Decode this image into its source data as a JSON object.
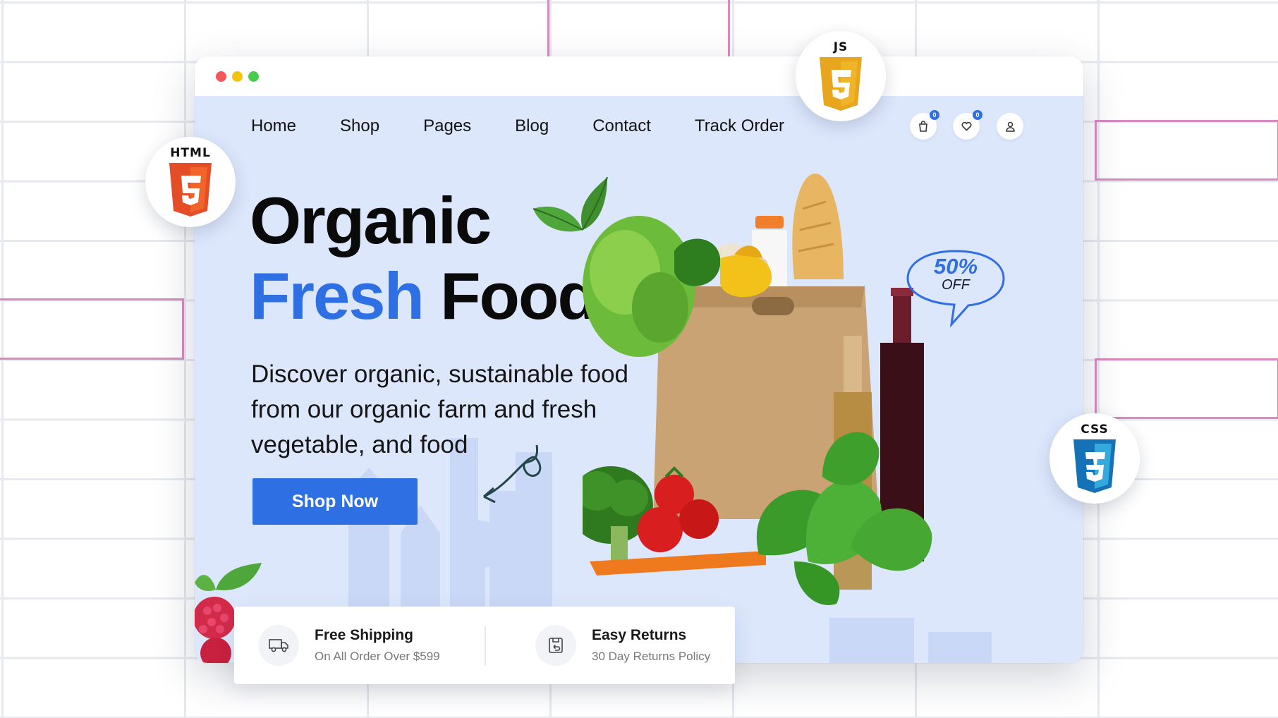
{
  "nav": {
    "items": [
      {
        "label": "Home"
      },
      {
        "label": "Shop"
      },
      {
        "label": "Pages"
      },
      {
        "label": "Blog"
      },
      {
        "label": "Contact"
      },
      {
        "label": "Track Order"
      }
    ],
    "cart_count": "0",
    "wishlist_count": "0"
  },
  "hero": {
    "title_line1": "Organic",
    "title_fresh": "Fresh",
    "title_food": "Food",
    "description": "Discover organic, sustainable food from our organic farm and fresh vegetable, and food",
    "cta_label": "Shop Now"
  },
  "promo": {
    "percent": "50%",
    "off": "OFF"
  },
  "features": [
    {
      "title": "Free Shipping",
      "subtitle": "On All Order Over $599",
      "icon": "truck-icon"
    },
    {
      "title": "Easy Returns",
      "subtitle": "30 Day Returns Policy",
      "icon": "return-box-icon"
    }
  ],
  "tech_badges": {
    "html": "HTML",
    "css": "CSS",
    "js": "JS",
    "html_color": "#e44d26",
    "css_color": "#2965f1",
    "js_color": "#f0b429"
  },
  "colors": {
    "accent": "#2f6fe4",
    "hero_bg": "#dce7fc"
  }
}
